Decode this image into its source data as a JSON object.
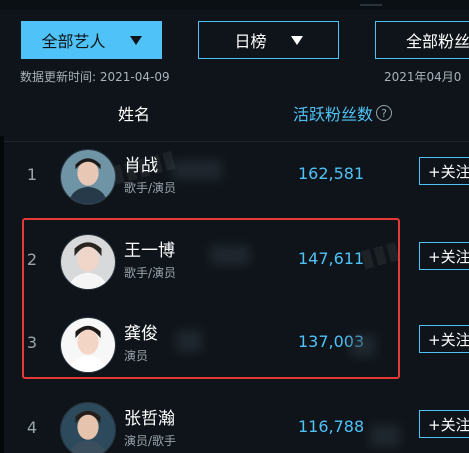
{
  "filters": {
    "category": "全部艺人",
    "period": "日榜",
    "metric": "全部粉丝"
  },
  "update_time": {
    "left": "数据更新时间: 2021-04-09",
    "right": "2021年04月0"
  },
  "columns": {
    "name": "姓名",
    "fans": "活跃粉丝数"
  },
  "follow_label": "+关注",
  "rows": [
    {
      "rank": "1",
      "name": "肖战",
      "role": "歌手/演员",
      "fans": "162,581"
    },
    {
      "rank": "2",
      "name": "王一博",
      "role": "歌手/演员",
      "fans": "147,611"
    },
    {
      "rank": "3",
      "name": "龚俊",
      "role": "演员",
      "fans": "137,003"
    },
    {
      "rank": "4",
      "name": "张哲瀚",
      "role": "演员/歌手",
      "fans": "116,788"
    }
  ],
  "colors": {
    "accent": "#4fc3f7",
    "background": "#0e1419",
    "highlight": "#e53935"
  },
  "icons": [
    "dropdown-triangle-icon",
    "help-icon"
  ]
}
